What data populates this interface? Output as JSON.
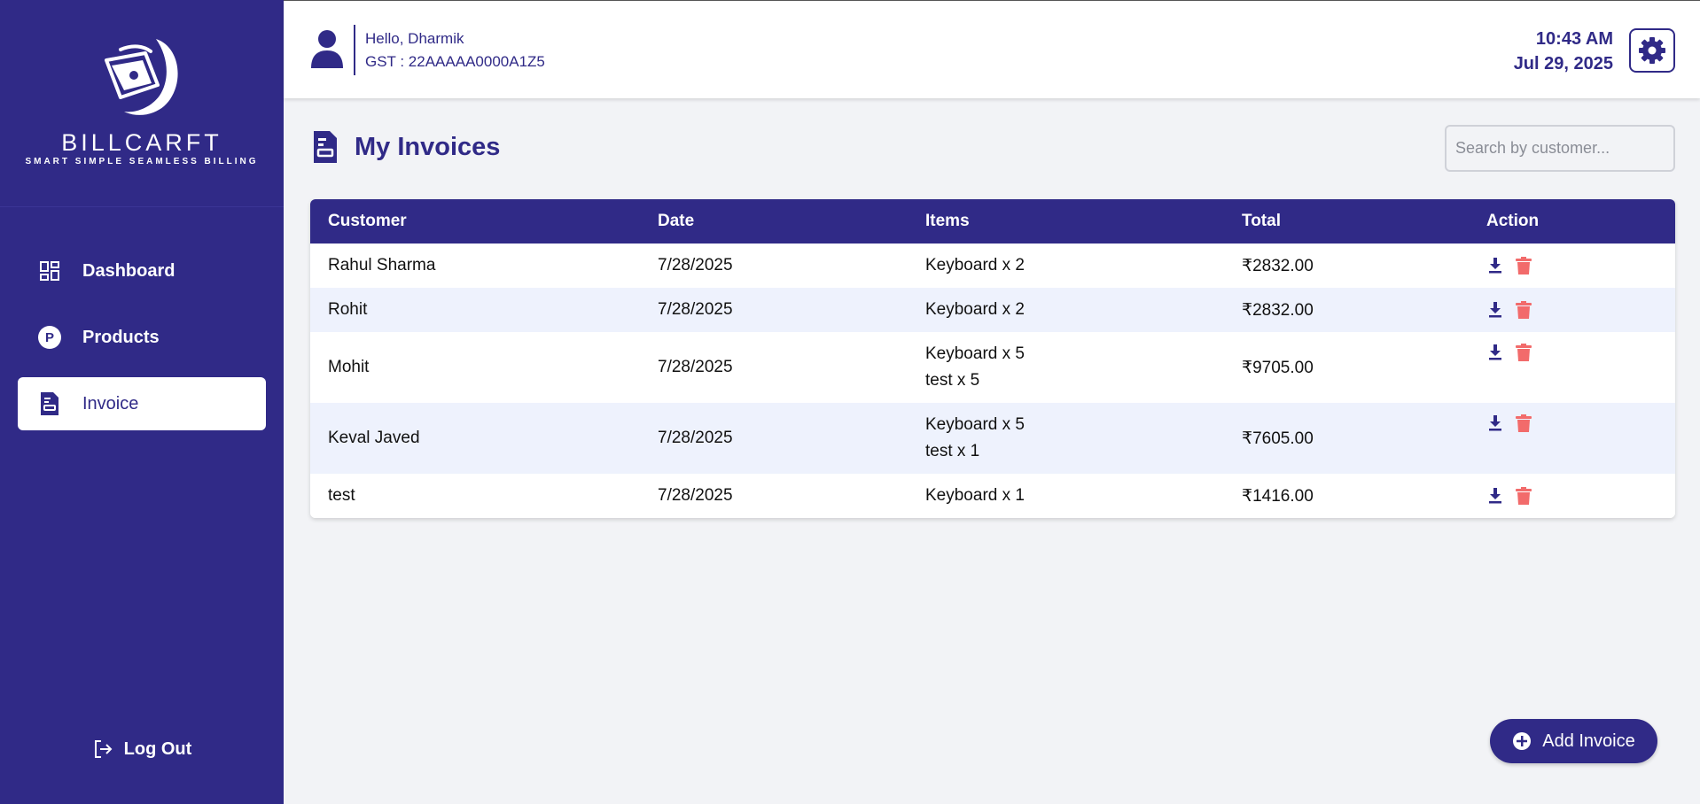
{
  "brand": {
    "name": "BILLCARFT",
    "tagline": "SMART SIMPLE SEAMLESS BILLING"
  },
  "sidebar": {
    "items": [
      {
        "label": "Dashboard",
        "icon": "dashboard-icon",
        "active": false
      },
      {
        "label": "Products",
        "icon": "products-icon",
        "active": false
      },
      {
        "label": "Invoice",
        "icon": "invoice-icon",
        "active": true
      }
    ],
    "logout_label": "Log Out"
  },
  "header": {
    "greeting": "Hello, Dharmik",
    "gst": "GST : 22AAAAA0000A1Z5",
    "time": "10:43 AM",
    "date": "Jul 29, 2025"
  },
  "main": {
    "title": "My Invoices",
    "search_placeholder": "Search by customer...",
    "columns": [
      "Customer",
      "Date",
      "Items",
      "Total",
      "Action"
    ],
    "rows": [
      {
        "customer": "Rahul Sharma",
        "date": "7/28/2025",
        "items": [
          "Keyboard x 2"
        ],
        "total": "₹2832.00"
      },
      {
        "customer": "Rohit",
        "date": "7/28/2025",
        "items": [
          "Keyboard x 2"
        ],
        "total": "₹2832.00"
      },
      {
        "customer": "Mohit",
        "date": "7/28/2025",
        "items": [
          "Keyboard x 5",
          "test x 5"
        ],
        "total": "₹9705.00"
      },
      {
        "customer": "Keval Javed",
        "date": "7/28/2025",
        "items": [
          "Keyboard x 5",
          "test x 1"
        ],
        "total": "₹7605.00"
      },
      {
        "customer": "test",
        "date": "7/28/2025",
        "items": [
          "Keyboard x 1"
        ],
        "total": "₹1416.00"
      }
    ],
    "add_button_label": "Add Invoice"
  },
  "colors": {
    "primary": "#302a87",
    "delete": "#f26b6b",
    "row_alt": "#eef2fd",
    "background": "#f2f3f6"
  }
}
